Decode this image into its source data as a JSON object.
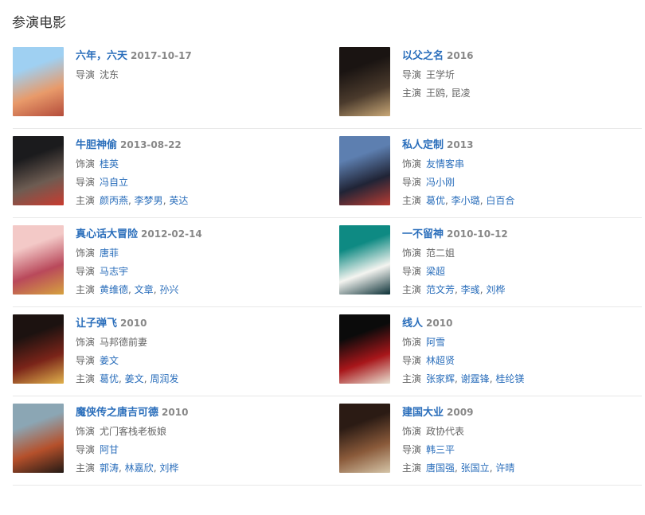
{
  "section_title": "参演电影",
  "movies": [
    {
      "title": "六年，六天",
      "date": "2017-10-17",
      "colors": [
        "#9fd0f2",
        "#e89a6a",
        "#b44c3b"
      ],
      "lines": [
        {
          "label": "导演",
          "linked": false,
          "names": [
            "沈东"
          ]
        }
      ]
    },
    {
      "title": "以父之名",
      "date": "2016",
      "colors": [
        "#1a1412",
        "#4a3a2c",
        "#c9a877"
      ],
      "lines": [
        {
          "label": "导演",
          "linked": false,
          "names": [
            "王学圻"
          ]
        },
        {
          "label": "主演",
          "linked": false,
          "names": [
            "王鸥, 昆凌"
          ]
        }
      ]
    },
    {
      "title": "牛胆神偷",
      "date": "2013-08-22",
      "colors": [
        "#1b1b1d",
        "#6d5c52",
        "#c93b2f"
      ],
      "lines": [
        {
          "label": "饰演",
          "linked": true,
          "names": [
            "桂英"
          ]
        },
        {
          "label": "导演",
          "linked": true,
          "names": [
            "冯自立"
          ]
        },
        {
          "label": "主演",
          "linked": true,
          "names": [
            "颜丙燕",
            "李梦男",
            "英达"
          ]
        }
      ]
    },
    {
      "title": "私人定制",
      "date": "2013",
      "colors": [
        "#5d7fb0",
        "#202436",
        "#b93c33"
      ],
      "lines": [
        {
          "label": "饰演",
          "linked": true,
          "names": [
            "友情客串"
          ]
        },
        {
          "label": "导演",
          "linked": true,
          "names": [
            "冯小刚"
          ]
        },
        {
          "label": "主演",
          "linked": true,
          "names": [
            "葛优",
            "李小璐",
            "白百合"
          ]
        }
      ]
    },
    {
      "title": "真心话大冒险",
      "date": "2012-02-14",
      "colors": [
        "#f3c9c7",
        "#b9495b",
        "#d6a23f"
      ],
      "lines": [
        {
          "label": "饰演",
          "linked": true,
          "names": [
            "唐菲"
          ]
        },
        {
          "label": "导演",
          "linked": true,
          "names": [
            "马志宇"
          ]
        },
        {
          "label": "主演",
          "linked": true,
          "names": [
            "黄维德",
            "文章",
            "孙兴"
          ]
        }
      ]
    },
    {
      "title": "一不留神",
      "date": "2010-10-12",
      "colors": [
        "#0e8a83",
        "#f4f4f0",
        "#0b3036"
      ],
      "lines": [
        {
          "label": "饰演",
          "linked": false,
          "names": [
            "范二姐"
          ]
        },
        {
          "label": "导演",
          "linked": true,
          "names": [
            "梁超"
          ]
        },
        {
          "label": "主演",
          "linked": true,
          "names": [
            "范文芳",
            "李彧",
            "刘桦"
          ]
        }
      ]
    },
    {
      "title": "让子弹飞",
      "date": "2010",
      "colors": [
        "#1c1210",
        "#7a2419",
        "#e1b24c"
      ],
      "lines": [
        {
          "label": "饰演",
          "linked": false,
          "names": [
            "马邦德前妻"
          ]
        },
        {
          "label": "导演",
          "linked": true,
          "names": [
            "姜文"
          ]
        },
        {
          "label": "主演",
          "linked": true,
          "names": [
            "葛优",
            "姜文",
            "周润发"
          ]
        }
      ]
    },
    {
      "title": "线人",
      "date": "2010",
      "colors": [
        "#0b0b0b",
        "#a8161a",
        "#e9e2d3"
      ],
      "lines": [
        {
          "label": "饰演",
          "linked": true,
          "names": [
            "阿雪"
          ]
        },
        {
          "label": "导演",
          "linked": true,
          "names": [
            "林超贤"
          ]
        },
        {
          "label": "主演",
          "linked": true,
          "names": [
            "张家辉",
            "谢霆锋",
            "桂纶镁"
          ]
        }
      ]
    },
    {
      "title": "魔侠传之唐吉可德",
      "date": "2010",
      "colors": [
        "#8ba6b4",
        "#b5502b",
        "#231a15"
      ],
      "lines": [
        {
          "label": "饰演",
          "linked": false,
          "names": [
            "尤门客栈老板娘"
          ]
        },
        {
          "label": "导演",
          "linked": true,
          "names": [
            "阿甘"
          ]
        },
        {
          "label": "主演",
          "linked": true,
          "names": [
            "郭涛",
            "林嘉欣",
            "刘桦"
          ]
        }
      ]
    },
    {
      "title": "建国大业",
      "date": "2009",
      "colors": [
        "#2b1b14",
        "#8a5a3a",
        "#d5c5a8"
      ],
      "lines": [
        {
          "label": "饰演",
          "linked": false,
          "names": [
            "政协代表"
          ]
        },
        {
          "label": "导演",
          "linked": true,
          "names": [
            "韩三平"
          ]
        },
        {
          "label": "主演",
          "linked": true,
          "names": [
            "唐国强",
            "张国立",
            "许晴"
          ]
        }
      ]
    }
  ]
}
